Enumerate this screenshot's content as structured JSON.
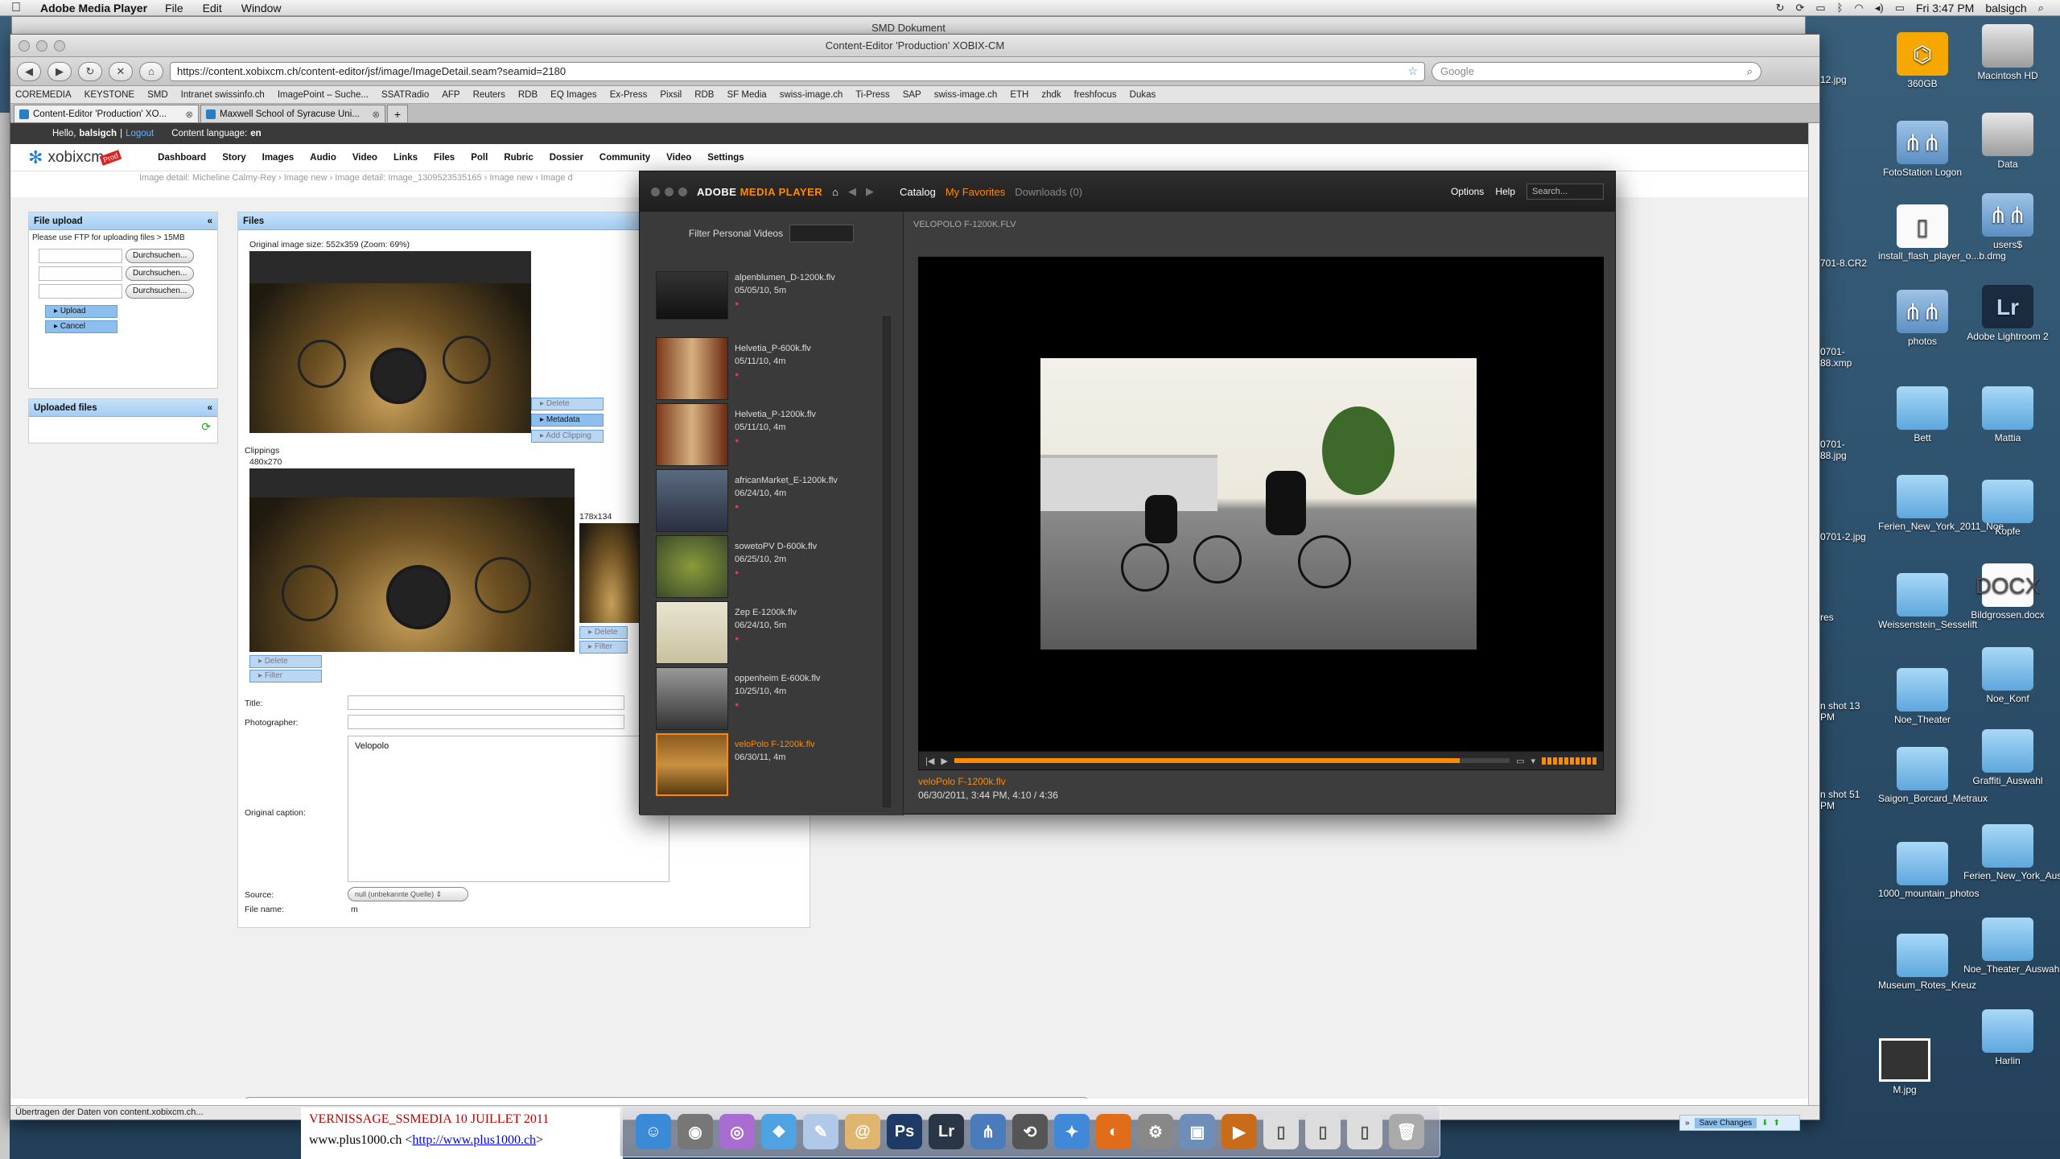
{
  "menubar": {
    "app": "Adobe Media Player",
    "items": [
      "File",
      "Edit",
      "Window"
    ],
    "clock": "Fri 3:47 PM",
    "user": "balsigch"
  },
  "smd_window": {
    "title": "SMD Dokument"
  },
  "browser": {
    "title": "Content-Editor 'Production' XOBIX-CM",
    "url": "https://content.xobixcm.ch/content-editor/jsf/image/ImageDetail.seam?seamid=2180",
    "search_placeholder": "Google",
    "bookmarks": [
      "COREMEDIA",
      "KEYSTONE",
      "SMD",
      "Intranet swissinfo.ch",
      "ImagePoint – Suche...",
      "SSATRadio",
      "AFP",
      "Reuters",
      "RDB",
      "EQ Images",
      "Ex-Press",
      "Pixsil",
      "RDB",
      "SF Media",
      "swiss-image.ch",
      "Ti-Press",
      "SAP",
      "swiss-image.ch",
      "ETH",
      "zhdk",
      "freshfocus",
      "Dukas"
    ],
    "tabs": [
      {
        "label": "Content-Editor 'Production' XO..."
      },
      {
        "label": "Maxwell School of Syracuse Uni..."
      }
    ],
    "status": "Übertragen der Daten von content.xobixcm.ch..."
  },
  "cms": {
    "hello": "Hello,",
    "username": "balsigch",
    "logout": "Logout",
    "lang_label": "Content language:",
    "lang": "en",
    "logo": "xobixcm",
    "logo_badge": "Prod",
    "nav": [
      "Dashboard",
      "Story",
      "Images",
      "Audio",
      "Video",
      "Links",
      "Files",
      "Poll",
      "Rubric",
      "Dossier",
      "Community",
      "Video",
      "Settings"
    ],
    "breadcrumb": "Image detail: Micheline Calmy-Rey   ›   Image new   ›   Image detail: Image_1309523535165   ›   Image new   ›   Image d",
    "upload": {
      "title": "File upload",
      "note": "Please use FTP for uploading files > 15MB",
      "browse": "Durchsuchen...",
      "upload_btn": "Upload",
      "cancel_btn": "Cancel"
    },
    "uploaded": {
      "title": "Uploaded files"
    },
    "files": {
      "title": "Files",
      "orig_size": "Original image size: 552x359 (Zoom: 69%)",
      "delete": "Delete",
      "metadata": "Metadata",
      "add_clipping": "Add Clipping",
      "clippings": "Clippings",
      "clip1": "480x270",
      "clip2": "178x134",
      "filter": "Filter",
      "title_lbl": "Title:",
      "photographer_lbl": "Photographer:",
      "caption_lbl": "Original caption:",
      "caption_val": "Velopolo",
      "source_lbl": "Source:",
      "source_val": "null (unbekannte Quelle)",
      "filename_lbl": "File name:",
      "filename_val": "m"
    },
    "save": "Save Changes"
  },
  "amp": {
    "brand": "ADOBE",
    "brand2": "MEDIA PLAYER",
    "catalog": "Catalog",
    "favorites": "My Favorites",
    "downloads": "Downloads (0)",
    "options": "Options",
    "help": "Help",
    "search": "Search...",
    "filter": "Filter Personal Videos",
    "now_title": "VELOPOLO F-1200K.FLV",
    "items": [
      {
        "name": "alpenblumen_D-1200k.flv",
        "date": "05/05/10, 5m"
      },
      {
        "name": "Helvetia_P-600k.flv",
        "date": "05/11/10, 4m"
      },
      {
        "name": "Helvetia_P-1200k.flv",
        "date": "05/11/10, 4m"
      },
      {
        "name": "africanMarket_E-1200k.flv",
        "date": "06/24/10, 4m"
      },
      {
        "name": "sowetoPV D-600k.flv",
        "date": "06/25/10, 2m"
      },
      {
        "name": "Zep E-1200k.flv",
        "date": "06/24/10, 5m"
      },
      {
        "name": "oppenheim E-600k.flv",
        "date": "10/25/10, 4m"
      },
      {
        "name": "veloPolo F-1200k.flv",
        "date": "06/30/11, 4m"
      }
    ],
    "info_title": "veloPolo F-1200k.flv",
    "info_meta": "06/30/2011, 3:44 PM,  4:10 / 4:36",
    "progress": 0.91
  },
  "desktop": {
    "icons": [
      {
        "label": "360GB"
      },
      {
        "label": "Macintosh HD"
      },
      {
        "label": "FotoStation Logon"
      },
      {
        "label": "Data"
      },
      {
        "label": "install_flash_player_o...b.dmg"
      },
      {
        "label": "users$"
      },
      {
        "label": "photos"
      },
      {
        "label": "Adobe Lightroom 2"
      },
      {
        "label": "Bett"
      },
      {
        "label": "Mattia"
      },
      {
        "label": "Ferien_New_York_2011_Noe"
      },
      {
        "label": "Kopfe"
      },
      {
        "label": "Weissenstein_Sesselift"
      },
      {
        "label": "Bildgrossen.docx"
      },
      {
        "label": "Noe_Theater"
      },
      {
        "label": "Noe_Konf"
      },
      {
        "label": "Saigon_Borcard_Metraux"
      },
      {
        "label": "Graffiti_Auswahl"
      },
      {
        "label": "1000_mountain_photos"
      },
      {
        "label": "Ferien_New_York_Auswahl"
      },
      {
        "label": "Museum_Rotes_Kreuz"
      },
      {
        "label": "Noe_Theater_Auswahl"
      },
      {
        "label": "Harlin"
      },
      {
        "label": "M.jpg"
      }
    ],
    "partials": [
      "12.jpg",
      "701-8.CR2",
      "0701-88.xmp",
      "0701-88.jpg",
      "0701-2.jpg",
      "res",
      "n shot 13 PM",
      "n shot 51 PM"
    ]
  },
  "bgwin": {
    "line1": "VERNISSAGE_SSMEDIA 10 JUILLET 2011",
    "line2": "www.plus1000.ch <",
    "link": "http://www.plus1000.ch",
    "line2b": ">"
  }
}
